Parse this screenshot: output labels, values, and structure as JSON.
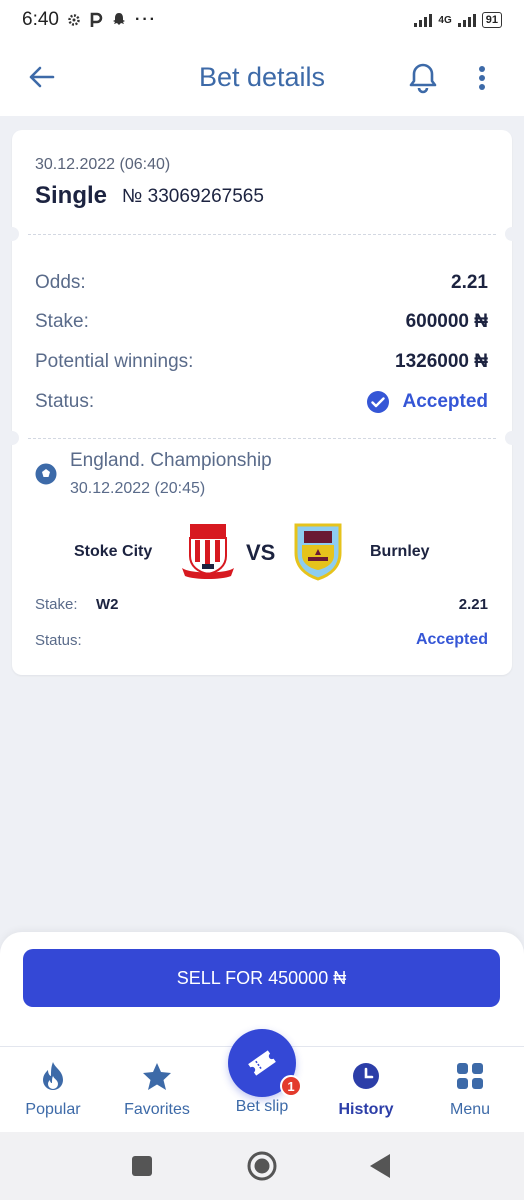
{
  "status_bar": {
    "time": "6:40",
    "network": "4G",
    "battery": "91"
  },
  "header": {
    "title": "Bet details"
  },
  "bet": {
    "date": "30.12.2022 (06:40)",
    "type": "Single",
    "number": "№ 33069267565",
    "odds_label": "Odds:",
    "odds_value": "2.21",
    "stake_label": "Stake:",
    "stake_value": "600000 ₦",
    "winnings_label": "Potential winnings:",
    "winnings_value": "1326000 ₦",
    "status_label": "Status:",
    "status_value": "Accepted"
  },
  "event": {
    "league": "England. Championship",
    "date": "30.12.2022 (20:45)",
    "team_home": "Stoke City",
    "vs": "VS",
    "team_away": "Burnley",
    "stake_label": "Stake:",
    "pick": "W2",
    "odds": "2.21",
    "status_label": "Status:",
    "status_value": "Accepted"
  },
  "actions": {
    "sell_label": "SELL FOR 450000 ₦"
  },
  "nav": {
    "items": [
      {
        "label": "Popular",
        "icon": "flame-icon"
      },
      {
        "label": "Favorites",
        "icon": "star-icon"
      },
      {
        "label": "Bet slip",
        "icon": "ticket-icon",
        "badge": "1"
      },
      {
        "label": "History",
        "icon": "clock-icon"
      },
      {
        "label": "Menu",
        "icon": "grid-icon"
      }
    ]
  },
  "colors": {
    "accent": "#3448d6",
    "title": "#3d6aa8",
    "danger": "#e33a2c"
  }
}
